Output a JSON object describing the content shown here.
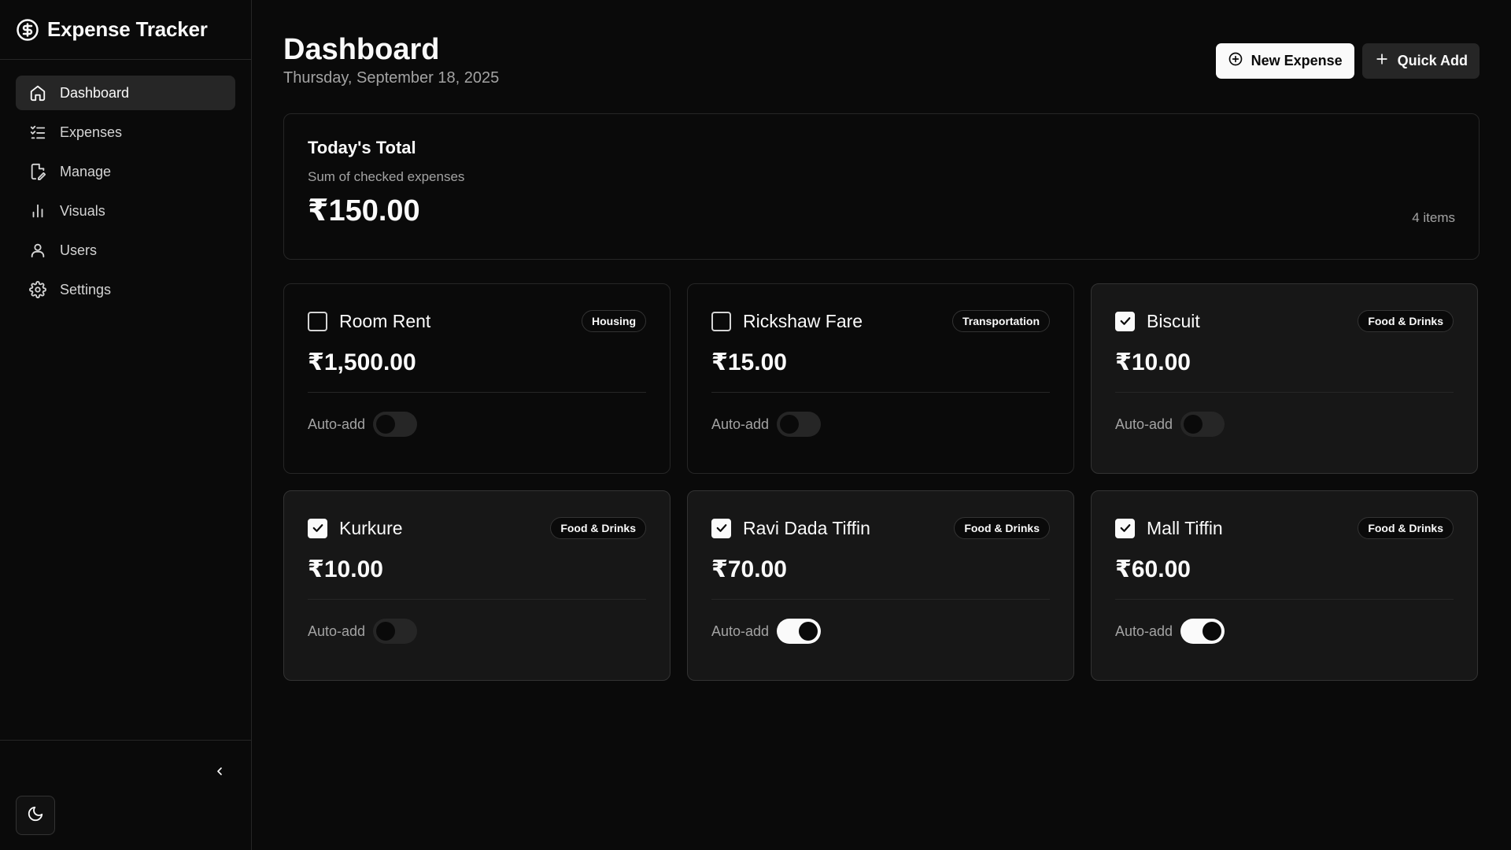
{
  "brand": {
    "title": "Expense Tracker",
    "icon": "dollar-circle-icon"
  },
  "sidebar": {
    "items": [
      {
        "label": "Dashboard",
        "icon": "home-icon",
        "active": true
      },
      {
        "label": "Expenses",
        "icon": "list-checks-icon",
        "active": false
      },
      {
        "label": "Manage",
        "icon": "file-edit-icon",
        "active": false
      },
      {
        "label": "Visuals",
        "icon": "bar-chart-icon",
        "active": false
      },
      {
        "label": "Users",
        "icon": "user-icon",
        "active": false
      },
      {
        "label": "Settings",
        "icon": "gear-icon",
        "active": false
      }
    ],
    "collapse_icon": "chevron-left-icon",
    "theme_icon": "moon-icon"
  },
  "header": {
    "title": "Dashboard",
    "date": "Thursday, September 18, 2025",
    "new_expense_label": "New Expense",
    "quick_add_label": "Quick Add"
  },
  "summary": {
    "title": "Today's Total",
    "subtitle": "Sum of checked expenses",
    "amount": "₹150.00",
    "count": "4 items"
  },
  "auto_add_label": "Auto-add",
  "expenses": [
    {
      "name": "Room Rent",
      "category": "Housing",
      "amount": "₹1,500.00",
      "checked": false,
      "auto_add": false
    },
    {
      "name": "Rickshaw Fare",
      "category": "Transportation",
      "amount": "₹15.00",
      "checked": false,
      "auto_add": false
    },
    {
      "name": "Biscuit",
      "category": "Food & Drinks",
      "amount": "₹10.00",
      "checked": true,
      "auto_add": false
    },
    {
      "name": "Kurkure",
      "category": "Food & Drinks",
      "amount": "₹10.00",
      "checked": true,
      "auto_add": false
    },
    {
      "name": "Ravi Dada Tiffin",
      "category": "Food & Drinks",
      "amount": "₹70.00",
      "checked": true,
      "auto_add": true
    },
    {
      "name": "Mall Tiffin",
      "category": "Food & Drinks",
      "amount": "₹60.00",
      "checked": true,
      "auto_add": true
    }
  ],
  "colors": {
    "background": "#0a0a0a",
    "card_checked": "#171717",
    "border": "#262626",
    "foreground": "#fafafa",
    "muted": "#a3a3a3"
  }
}
